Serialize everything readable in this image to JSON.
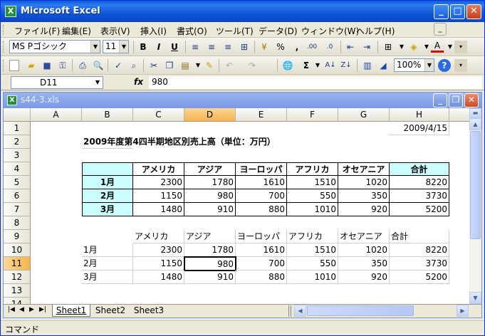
{
  "app": {
    "title": "Microsoft Excel"
  },
  "menu": [
    "ファイル(F)",
    "編集(E)",
    "表示(V)",
    "挿入(I)",
    "書式(O)",
    "ツール(T)",
    "データ(D)",
    "ウィンドウ(W)",
    "ヘルプ(H)"
  ],
  "format_toolbar": {
    "font": "MS Pゴシック",
    "size": "11",
    "bold": "B",
    "italic": "I",
    "underline": "U",
    "percent": "%",
    "comma": ","
  },
  "standard_toolbar": {
    "zoom": "100%",
    "sigma": "Σ"
  },
  "formula_bar": {
    "name_box": "D11",
    "fx": "fx",
    "value": "980"
  },
  "workbook": {
    "title": "s44-3.xls"
  },
  "columns": [
    "A",
    "B",
    "C",
    "D",
    "E",
    "F",
    "G",
    "H"
  ],
  "rows": [
    "1",
    "2",
    "3",
    "4",
    "5",
    "6",
    "7",
    "8",
    "9",
    "10",
    "11",
    "12",
    "13",
    "14"
  ],
  "cells": {
    "H1": "2009/4/15",
    "B2": "2009年度第4四半期地区別売上高（単位：万円）",
    "table1_headers": [
      "アメリカ",
      "アジア",
      "ヨーロッパ",
      "アフリカ",
      "オセアニア",
      "合計"
    ],
    "table1_rows": [
      {
        "label": "1月",
        "values": [
          "2300",
          "1780",
          "1610",
          "1510",
          "1020",
          "8220"
        ]
      },
      {
        "label": "2月",
        "values": [
          "1150",
          "980",
          "700",
          "550",
          "350",
          "3730"
        ]
      },
      {
        "label": "3月",
        "values": [
          "1480",
          "910",
          "880",
          "1010",
          "920",
          "5200"
        ]
      }
    ],
    "table2_headers": [
      "アメリカ",
      "アジア",
      "ヨーロッパ",
      "アフリカ",
      "オセアニア",
      "合計"
    ],
    "table2_rows": [
      {
        "label": "1月",
        "values": [
          "2300",
          "1780",
          "1610",
          "1510",
          "1020",
          "8220"
        ]
      },
      {
        "label": "2月",
        "values": [
          "1150",
          "980",
          "700",
          "550",
          "350",
          "3730"
        ]
      },
      {
        "label": "3月",
        "values": [
          "1480",
          "910",
          "880",
          "1010",
          "920",
          "5200"
        ]
      }
    ]
  },
  "sheets": [
    "Sheet1",
    "Sheet2",
    "Sheet3"
  ],
  "status": "コマンド",
  "colors": {
    "header_fill": "#ccffff",
    "selected_header": "#f6b44c",
    "title_blue": "#0a5ce0"
  }
}
